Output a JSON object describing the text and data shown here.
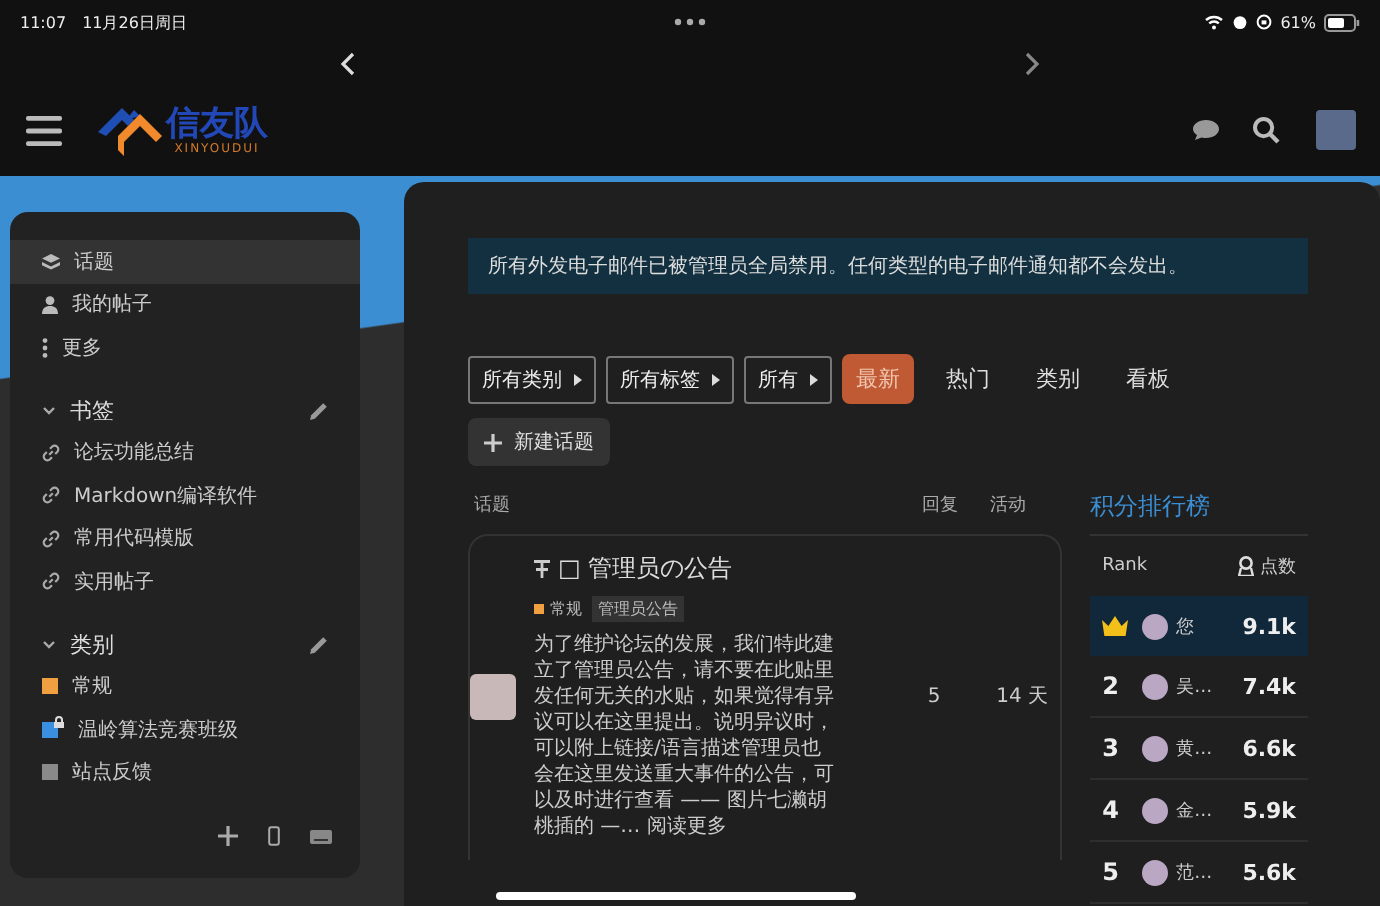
{
  "status_bar": {
    "time": "11:07",
    "date": "11月26日周日",
    "battery": "61%"
  },
  "header": {
    "logo_text": "信友队",
    "logo_subtext": "XINYOUDUI"
  },
  "sidebar": {
    "nav": [
      {
        "label": "话题",
        "selected": true
      },
      {
        "label": "我的帖子",
        "selected": false
      },
      {
        "label": "更多",
        "selected": false
      }
    ],
    "bookmarks": {
      "title": "书签",
      "expanded": true,
      "items": [
        "论坛功能总结",
        "Markdown编译软件",
        "常用代码模版",
        "实用帖子"
      ]
    },
    "categories": {
      "title": "类别",
      "expanded": true,
      "items": [
        {
          "label": "常规",
          "color": "#f0a040",
          "locked": false
        },
        {
          "label": "温岭算法竞赛班级",
          "color": "#3a8fe0",
          "locked": true
        },
        {
          "label": "站点反馈",
          "color": "#8a8a8a",
          "locked": false
        }
      ]
    }
  },
  "notice": "所有外发电子邮件已被管理员全局禁用。任何类型的电子邮件通知都不会发出。",
  "filters": [
    "所有类别",
    "所有标签",
    "所有"
  ],
  "tabs": [
    {
      "label": "最新",
      "selected": true
    },
    {
      "label": "热门",
      "selected": false
    },
    {
      "label": "类别",
      "selected": false
    },
    {
      "label": "看板",
      "selected": false
    }
  ],
  "new_topic_button": "新建话题",
  "topic_list": {
    "columns": [
      "话题",
      "回复",
      "活动"
    ],
    "topics": [
      {
        "title": "□ 管理员の公告",
        "pinned": true,
        "category": {
          "label": "常规",
          "color": "#f0a040"
        },
        "tags": [
          "管理员公告"
        ],
        "excerpt": "为了维护论坛的发展，我们特此建立了管理员公告，请不要在此贴里发任何无关的水贴，如果觉得有异议可以在这里提出。说明异议时，可以附上链接/语言描述管理员也会在这里发送重大事件的公告，可以及时进行查看 —— 图片七濑胡桃插的 —…",
        "read_more": "阅读更多",
        "replies": "5",
        "activity": "14 天"
      }
    ]
  },
  "leaderboard": {
    "title": "积分排行榜",
    "columns": [
      "Rank",
      "点数"
    ],
    "rows": [
      {
        "kind": "crown",
        "name": "您",
        "points": "9.1k",
        "selected": true
      },
      {
        "kind": "number",
        "rank": "2",
        "name": "吴…",
        "points": "7.4k",
        "selected": false
      },
      {
        "kind": "number",
        "rank": "3",
        "name": "黄…",
        "points": "6.6k",
        "selected": false
      },
      {
        "kind": "number",
        "rank": "4",
        "name": "金…",
        "points": "5.9k",
        "selected": false
      },
      {
        "kind": "number",
        "rank": "5",
        "name": "范…",
        "points": "5.6k",
        "selected": false
      }
    ]
  }
}
